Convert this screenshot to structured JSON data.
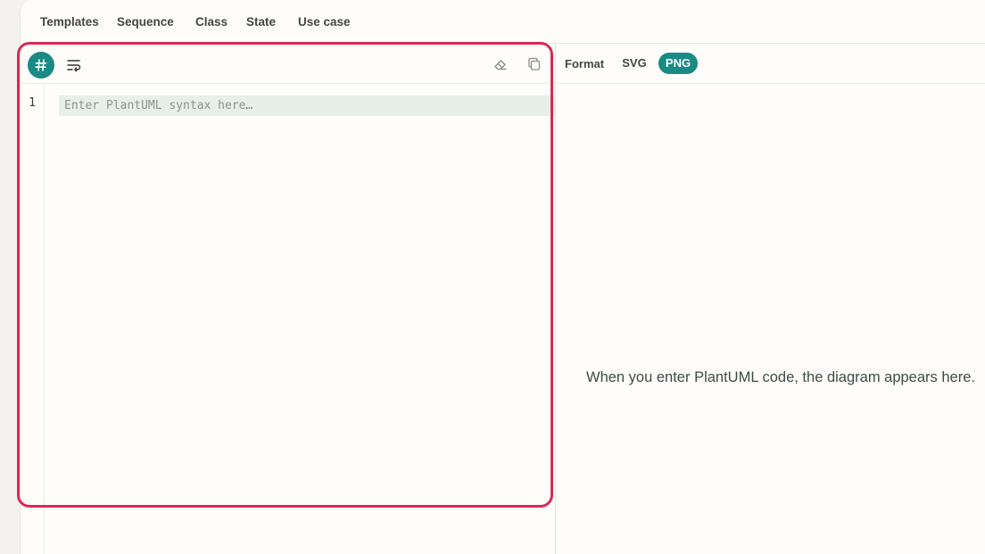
{
  "nav": {
    "items": [
      "Templates",
      "Sequence",
      "Class",
      "State",
      "Use case"
    ]
  },
  "editor": {
    "line_number": "1",
    "placeholder": "Enter PlantUML syntax here…",
    "value": "",
    "icons": {
      "hash": "hash-icon",
      "wrap": "wrap-lines-icon",
      "clear": "eraser-icon",
      "copy": "copy-icon"
    }
  },
  "preview": {
    "format_label": "Format",
    "options": [
      "SVG",
      "PNG"
    ],
    "selected": "PNG",
    "message": "When you enter PlantUML code, the diagram appears here."
  },
  "colors": {
    "accent": "#1a8a84",
    "highlight": "#d92a56",
    "active_line": "#e6efea",
    "background": "#fefdfa"
  }
}
